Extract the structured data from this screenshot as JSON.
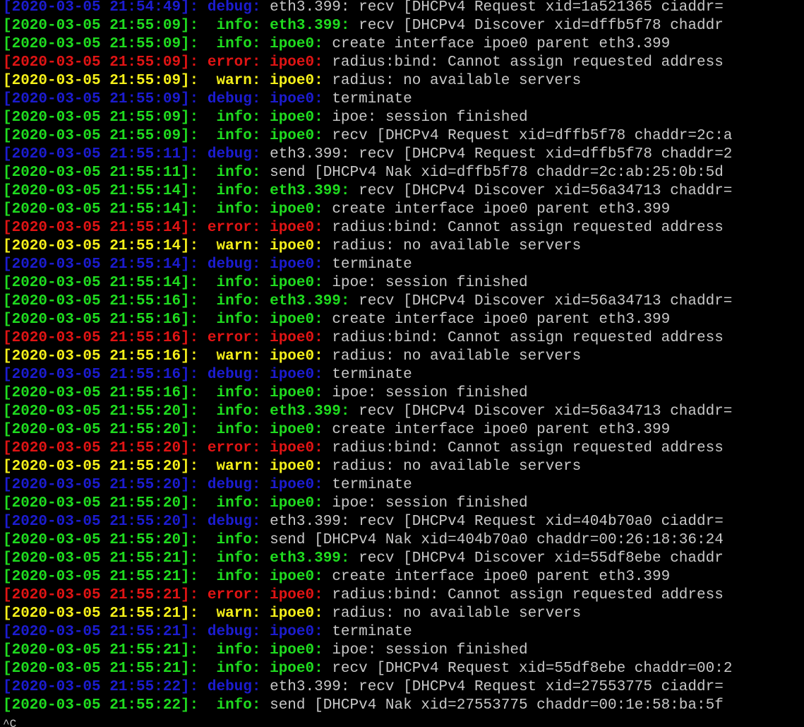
{
  "colors": {
    "green": "#1fdc1f",
    "red": "#e01414",
    "yellow": "#f5f01a",
    "blue": "#1c1cd0",
    "white": "#c8c8c8",
    "background": "#000000"
  },
  "lines": [
    {
      "ts": "[2020-03-05 21:54:49]:",
      "level": "debug:",
      "iface": "",
      "msg": "eth3.399: recv [DHCPv4 Request xid=1a521365 ciaddr=",
      "color": "blue",
      "iface_color": "blue"
    },
    {
      "ts": "[2020-03-05 21:55:09]:",
      "level": " info:",
      "iface": "eth3.399:",
      "msg": "recv [DHCPv4 Discover xid=dffb5f78 chaddr",
      "color": "green",
      "iface_color": "green"
    },
    {
      "ts": "[2020-03-05 21:55:09]:",
      "level": " info:",
      "iface": "ipoe0:",
      "msg": "create interface ipoe0 parent eth3.399",
      "color": "green",
      "iface_color": "green"
    },
    {
      "ts": "[2020-03-05 21:55:09]:",
      "level": "error:",
      "iface": "ipoe0:",
      "msg": "radius:bind: Cannot assign requested address",
      "color": "red",
      "iface_color": "red"
    },
    {
      "ts": "[2020-03-05 21:55:09]:",
      "level": " warn:",
      "iface": "ipoe0:",
      "msg": "radius: no available servers",
      "color": "yellow",
      "iface_color": "yellow"
    },
    {
      "ts": "[2020-03-05 21:55:09]:",
      "level": "debug:",
      "iface": "ipoe0:",
      "msg": "terminate",
      "color": "blue",
      "iface_color": "blue"
    },
    {
      "ts": "[2020-03-05 21:55:09]:",
      "level": " info:",
      "iface": "ipoe0:",
      "msg": "ipoe: session finished",
      "color": "green",
      "iface_color": "green"
    },
    {
      "ts": "[2020-03-05 21:55:09]:",
      "level": " info:",
      "iface": "ipoe0:",
      "msg": "recv [DHCPv4 Request xid=dffb5f78 chaddr=2c:a",
      "color": "green",
      "iface_color": "green"
    },
    {
      "ts": "[2020-03-05 21:55:11]:",
      "level": "debug:",
      "iface": "",
      "msg": "eth3.399: recv [DHCPv4 Request xid=dffb5f78 chaddr=2",
      "color": "blue",
      "iface_color": "blue"
    },
    {
      "ts": "[2020-03-05 21:55:11]:",
      "level": " info:",
      "iface": "",
      "msg": "send [DHCPv4 Nak xid=dffb5f78 chaddr=2c:ab:25:0b:5d",
      "color": "green",
      "iface_color": "green"
    },
    {
      "ts": "[2020-03-05 21:55:14]:",
      "level": " info:",
      "iface": "eth3.399:",
      "msg": "recv [DHCPv4 Discover xid=56a34713 chaddr=",
      "color": "green",
      "iface_color": "green"
    },
    {
      "ts": "[2020-03-05 21:55:14]:",
      "level": " info:",
      "iface": "ipoe0:",
      "msg": "create interface ipoe0 parent eth3.399",
      "color": "green",
      "iface_color": "green"
    },
    {
      "ts": "[2020-03-05 21:55:14]:",
      "level": "error:",
      "iface": "ipoe0:",
      "msg": "radius:bind: Cannot assign requested address",
      "color": "red",
      "iface_color": "red"
    },
    {
      "ts": "[2020-03-05 21:55:14]:",
      "level": " warn:",
      "iface": "ipoe0:",
      "msg": "radius: no available servers",
      "color": "yellow",
      "iface_color": "yellow"
    },
    {
      "ts": "[2020-03-05 21:55:14]:",
      "level": "debug:",
      "iface": "ipoe0:",
      "msg": "terminate",
      "color": "blue",
      "iface_color": "blue"
    },
    {
      "ts": "[2020-03-05 21:55:14]:",
      "level": " info:",
      "iface": "ipoe0:",
      "msg": "ipoe: session finished",
      "color": "green",
      "iface_color": "green"
    },
    {
      "ts": "[2020-03-05 21:55:16]:",
      "level": " info:",
      "iface": "eth3.399:",
      "msg": "recv [DHCPv4 Discover xid=56a34713 chaddr=",
      "color": "green",
      "iface_color": "green"
    },
    {
      "ts": "[2020-03-05 21:55:16]:",
      "level": " info:",
      "iface": "ipoe0:",
      "msg": "create interface ipoe0 parent eth3.399",
      "color": "green",
      "iface_color": "green"
    },
    {
      "ts": "[2020-03-05 21:55:16]:",
      "level": "error:",
      "iface": "ipoe0:",
      "msg": "radius:bind: Cannot assign requested address",
      "color": "red",
      "iface_color": "red"
    },
    {
      "ts": "[2020-03-05 21:55:16]:",
      "level": " warn:",
      "iface": "ipoe0:",
      "msg": "radius: no available servers",
      "color": "yellow",
      "iface_color": "yellow"
    },
    {
      "ts": "[2020-03-05 21:55:16]:",
      "level": "debug:",
      "iface": "ipoe0:",
      "msg": "terminate",
      "color": "blue",
      "iface_color": "blue"
    },
    {
      "ts": "[2020-03-05 21:55:16]:",
      "level": " info:",
      "iface": "ipoe0:",
      "msg": "ipoe: session finished",
      "color": "green",
      "iface_color": "green"
    },
    {
      "ts": "[2020-03-05 21:55:20]:",
      "level": " info:",
      "iface": "eth3.399:",
      "msg": "recv [DHCPv4 Discover xid=56a34713 chaddr=",
      "color": "green",
      "iface_color": "green"
    },
    {
      "ts": "[2020-03-05 21:55:20]:",
      "level": " info:",
      "iface": "ipoe0:",
      "msg": "create interface ipoe0 parent eth3.399",
      "color": "green",
      "iface_color": "green"
    },
    {
      "ts": "[2020-03-05 21:55:20]:",
      "level": "error:",
      "iface": "ipoe0:",
      "msg": "radius:bind: Cannot assign requested address",
      "color": "red",
      "iface_color": "red"
    },
    {
      "ts": "[2020-03-05 21:55:20]:",
      "level": " warn:",
      "iface": "ipoe0:",
      "msg": "radius: no available servers",
      "color": "yellow",
      "iface_color": "yellow"
    },
    {
      "ts": "[2020-03-05 21:55:20]:",
      "level": "debug:",
      "iface": "ipoe0:",
      "msg": "terminate",
      "color": "blue",
      "iface_color": "blue"
    },
    {
      "ts": "[2020-03-05 21:55:20]:",
      "level": " info:",
      "iface": "ipoe0:",
      "msg": "ipoe: session finished",
      "color": "green",
      "iface_color": "green"
    },
    {
      "ts": "[2020-03-05 21:55:20]:",
      "level": "debug:",
      "iface": "",
      "msg": "eth3.399: recv [DHCPv4 Request xid=404b70a0 ciaddr=",
      "color": "blue",
      "iface_color": "blue"
    },
    {
      "ts": "[2020-03-05 21:55:20]:",
      "level": " info:",
      "iface": "",
      "msg": "send [DHCPv4 Nak xid=404b70a0 chaddr=00:26:18:36:24",
      "color": "green",
      "iface_color": "green"
    },
    {
      "ts": "[2020-03-05 21:55:21]:",
      "level": " info:",
      "iface": "eth3.399:",
      "msg": "recv [DHCPv4 Discover xid=55df8ebe chaddr",
      "color": "green",
      "iface_color": "green"
    },
    {
      "ts": "[2020-03-05 21:55:21]:",
      "level": " info:",
      "iface": "ipoe0:",
      "msg": "create interface ipoe0 parent eth3.399",
      "color": "green",
      "iface_color": "green"
    },
    {
      "ts": "[2020-03-05 21:55:21]:",
      "level": "error:",
      "iface": "ipoe0:",
      "msg": "radius:bind: Cannot assign requested address",
      "color": "red",
      "iface_color": "red"
    },
    {
      "ts": "[2020-03-05 21:55:21]:",
      "level": " warn:",
      "iface": "ipoe0:",
      "msg": "radius: no available servers",
      "color": "yellow",
      "iface_color": "yellow"
    },
    {
      "ts": "[2020-03-05 21:55:21]:",
      "level": "debug:",
      "iface": "ipoe0:",
      "msg": "terminate",
      "color": "blue",
      "iface_color": "blue"
    },
    {
      "ts": "[2020-03-05 21:55:21]:",
      "level": " info:",
      "iface": "ipoe0:",
      "msg": "ipoe: session finished",
      "color": "green",
      "iface_color": "green"
    },
    {
      "ts": "[2020-03-05 21:55:21]:",
      "level": " info:",
      "iface": "ipoe0:",
      "msg": "recv [DHCPv4 Request xid=55df8ebe chaddr=00:2",
      "color": "green",
      "iface_color": "green"
    },
    {
      "ts": "[2020-03-05 21:55:22]:",
      "level": "debug:",
      "iface": "",
      "msg": "eth3.399: recv [DHCPv4 Request xid=27553775 ciaddr=",
      "color": "blue",
      "iface_color": "blue"
    },
    {
      "ts": "[2020-03-05 21:55:22]:",
      "level": " info:",
      "iface": "",
      "msg": "send [DHCPv4 Nak xid=27553775 chaddr=00:1e:58:ba:5f",
      "color": "green",
      "iface_color": "green"
    }
  ],
  "prompt": "^C"
}
